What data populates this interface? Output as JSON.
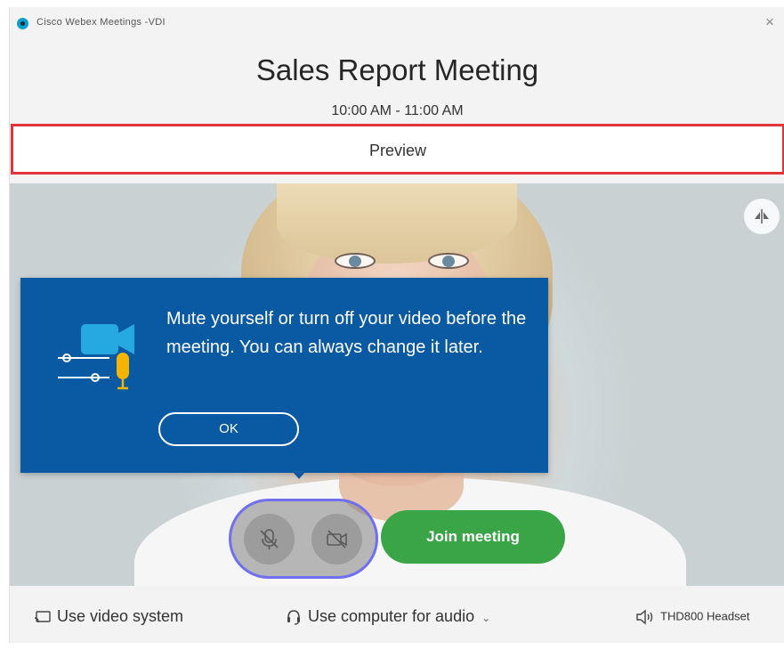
{
  "window": {
    "title": "Cisco Webex Meetings -VDI",
    "close_glyph": "×"
  },
  "meeting": {
    "title": "Sales Report Meeting",
    "time": "10:00 AM - 11:00 AM"
  },
  "preview": {
    "label": "Preview"
  },
  "tooltip": {
    "message": "Mute yourself or turn off your video before the meeting. You can always change it later.",
    "ok_label": "OK",
    "illustration_icon": "mute-video-settings-icon"
  },
  "controls": {
    "mute_icon": "microphone-muted-icon",
    "video_icon": "video-off-icon",
    "join_label": "Join meeting"
  },
  "bottom_bar": {
    "video_system_label": "Use video system",
    "audio_label": "Use computer for audio",
    "audio_chevron": "⌄",
    "headset_label": "THD800 Headset"
  },
  "colors": {
    "tooltip_bg": "#0a5aa3",
    "join_button": "#3aa547",
    "preview_highlight": "#e2353b",
    "controls_highlight": "#6f6ff0"
  }
}
